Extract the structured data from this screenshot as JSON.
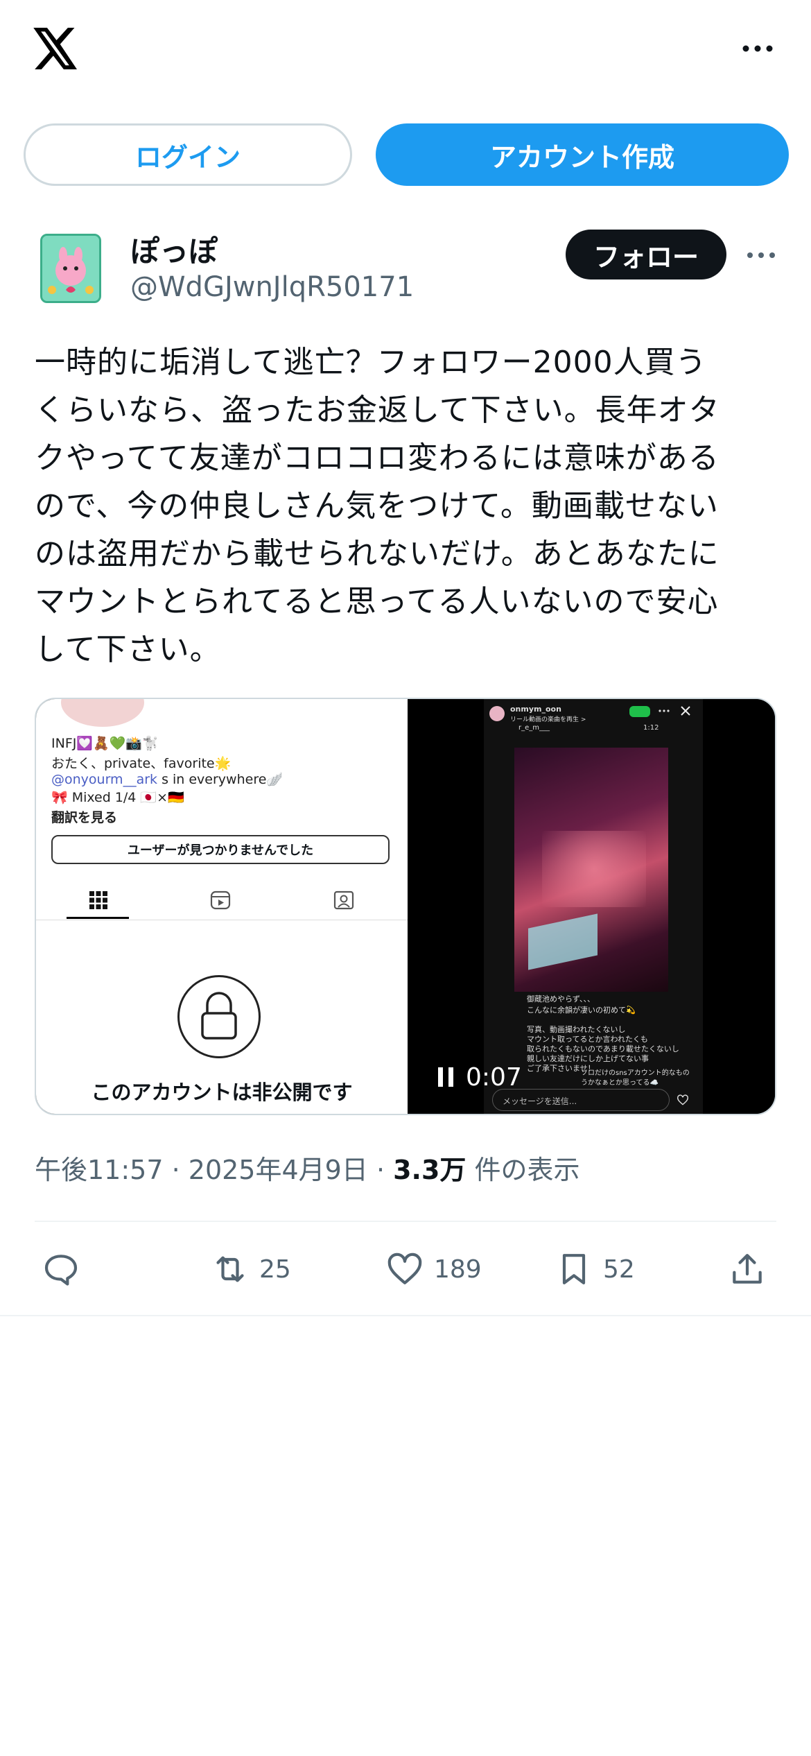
{
  "header": {
    "logo_icon": "x-logo-icon",
    "more_icon": "more-icon"
  },
  "auth": {
    "login_label": "ログイン",
    "signup_label": "アカウント作成"
  },
  "post": {
    "display_name": "ぽっぽ",
    "handle": "@WdGJwnJlqR50171",
    "follow_label": "フォロー",
    "text": "一時的に垢消して逃亡？フォロワー2000人買う\nくらいなら、盗ったお金返して下さい。長年オタ\nクやってて友達がコロコロ変わるには意味がある\nので、今の仲良しさん気をつけて。動画載せない\nのは盗用だから載せられないだけ。あとあなたに\nマウントとられてると思ってる人いないので安心\nして下さい。",
    "media": {
      "left": {
        "bio_line1": "INFJ💟🧸💚📸🐩",
        "bio_line2": "おたく、private、favorite🌟",
        "bio_link": "@onyourm__ark",
        "bio_line3_suffix": " s in everywhere🪽",
        "bio_line4": "🎀 Mixed 1/4 🇯🇵×🇩🇪",
        "translate": "翻訳を見る",
        "user_not_found": "ユーザーが見つかりませんでした",
        "private_notice": "このアカウントは非公開です"
      },
      "right": {
        "story_user": "onmym_oon",
        "story_sub": "リール動画の楽曲を再生 >",
        "story_name": "r_e_m___",
        "story_time": "1:12",
        "caption1": "御蔵池めやらず、、、",
        "caption2": "こんなに余韻が凄いの初めて💫",
        "caption3": "写真、動画撮われたくないし",
        "caption4": "マウント取ってるとか言われたくも",
        "caption5": "取られたくもないのであまり載せたくないし",
        "caption6": "親しい友達だけにしか上げてない事",
        "caption7": "ご了承下さいませ！",
        "caption8": "ソロだけのsnsアカウント的なもの",
        "caption9": "うかなぁとか思ってる☁️",
        "message_placeholder": "メッセージを送信...",
        "video_time": "0:07"
      }
    },
    "time": "午後11:57",
    "date": "2025年4月9日",
    "views_count": "3.3万",
    "views_label": "件の表示",
    "retweets": "25",
    "likes": "189",
    "bookmarks": "52"
  }
}
